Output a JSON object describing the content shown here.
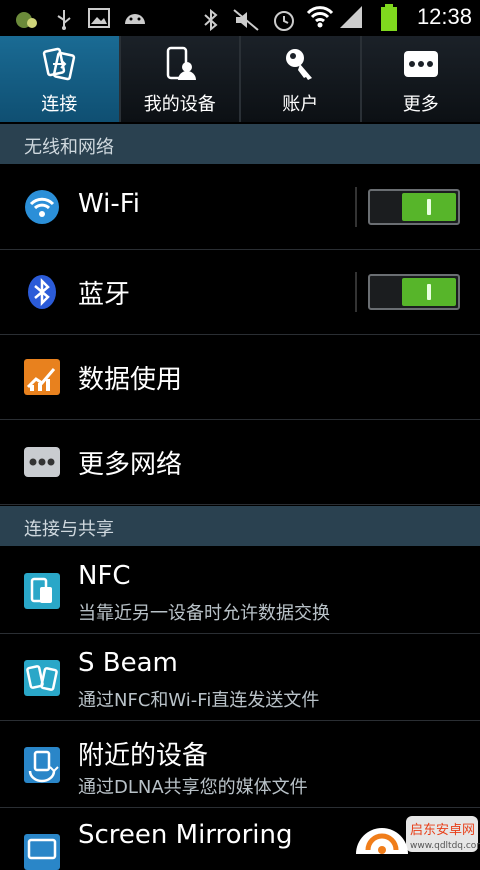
{
  "status_bar": {
    "time": "12:38"
  },
  "tabs": [
    {
      "label": "连接",
      "icon": "connections-icon",
      "active": true
    },
    {
      "label": "我的设备",
      "icon": "my-device-icon",
      "active": false
    },
    {
      "label": "账户",
      "icon": "key-icon",
      "active": false
    },
    {
      "label": "更多",
      "icon": "more-dots-icon",
      "active": false
    }
  ],
  "sections": {
    "wireless": "无线和网络",
    "sharing": "连接与共享"
  },
  "rows": {
    "wifi": {
      "title": "Wi-Fi",
      "toggle_on": true
    },
    "bluetooth": {
      "title": "蓝牙",
      "toggle_on": true
    },
    "data_usage": {
      "title": "数据使用"
    },
    "more_networks": {
      "title": "更多网络"
    },
    "nfc": {
      "title": "NFC",
      "sub": "当靠近另一设备时允许数据交换"
    },
    "sbeam": {
      "title": "S Beam",
      "sub": "通过NFC和Wi-Fi直连发送文件"
    },
    "nearby": {
      "title": "附近的设备",
      "sub": "通过DLNA共享您的媒体文件"
    },
    "mirroring": {
      "title": "Screen Mirroring"
    }
  },
  "watermark": {
    "text": "启东安卓网",
    "url": "www.qdltdq.com"
  },
  "colors": {
    "tab_active": "#1a6b94",
    "section_bg": "#2a4150",
    "toggle_on": "#57b52a",
    "battery": "#7fd81e"
  }
}
